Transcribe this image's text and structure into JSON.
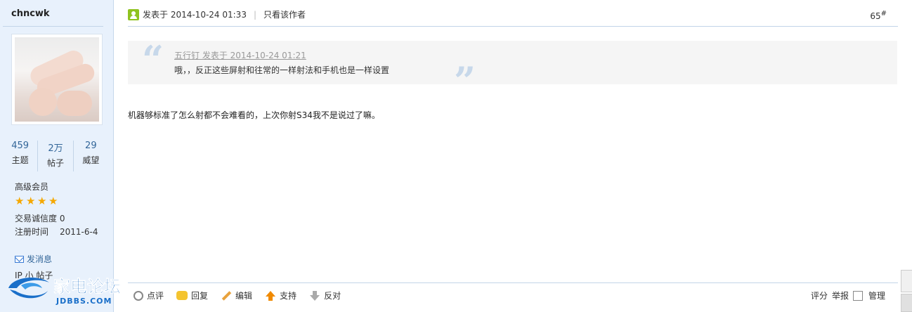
{
  "sidebar": {
    "username": "chncwk",
    "stats": [
      {
        "num": "459",
        "label": "主题"
      },
      {
        "num": "2万",
        "label": "帖子"
      },
      {
        "num": "29",
        "label": "威望"
      }
    ],
    "group": "高级会员",
    "star_count": 4,
    "credit": "交易诚信度 0",
    "reg_label": "注册时间",
    "reg_date": "2011-6-4",
    "pm_label": "发消息",
    "ip_text": "IP 小   帖子"
  },
  "logo": {
    "name": "家电论坛",
    "domain": "JDBBS.COM"
  },
  "post": {
    "posted": "发表于 2014-10-24 01:33",
    "only_author": "只看该作者",
    "floor": "65",
    "floor_sup": "#",
    "quote": {
      "head": "五行钉 发表于 2014-10-24 01:21",
      "text": "哦，，反正这些屏射和往常的一样射法和手机也是一样设置"
    },
    "content": "机器够标准了怎么射都不会难看的，上次你射S34我不是说过了嘛。"
  },
  "actions": {
    "rate": "点评",
    "reply": "回复",
    "edit": "编辑",
    "support": "支持",
    "oppose": "反对"
  },
  "right_actions": {
    "score": "评分",
    "report": "举报",
    "manage": "管理"
  }
}
